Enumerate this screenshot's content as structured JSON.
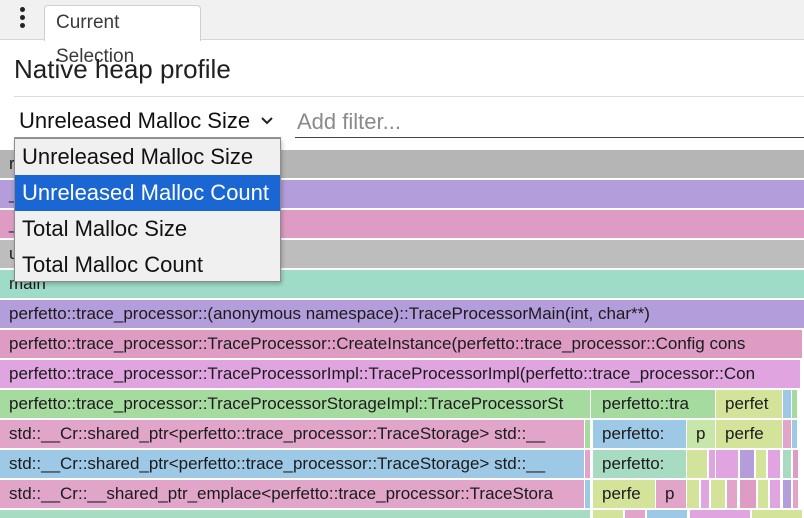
{
  "tab": {
    "label": "Current Selection"
  },
  "panel": {
    "title": "Native heap profile"
  },
  "metric_select": {
    "selected": "Unreleased Malloc Size",
    "options": [
      "Unreleased Malloc Size",
      "Unreleased Malloc Count",
      "Total Malloc Size",
      "Total Malloc Count"
    ],
    "highlighted": "Unreleased Malloc Count"
  },
  "filter": {
    "placeholder": "Add filter..."
  },
  "flamegraph": {
    "rows": [
      {
        "cells": [
          {
            "text": "r",
            "color": "#b5b5b5"
          }
        ]
      },
      {
        "cells": [
          {
            "text": "_",
            "color": "#b39ddb"
          }
        ]
      },
      {
        "cells": [
          {
            "text": "_",
            "color": "#de9cc4"
          }
        ]
      },
      {
        "cells": [
          {
            "text": "u",
            "color": "#bdbdbd"
          }
        ]
      },
      {
        "cells": [
          {
            "text": "main",
            "color": "#9fdcc7"
          }
        ]
      },
      {
        "cells": [
          {
            "text": "perfetto::trace_processor::(anonymous namespace)::TraceProcessorMain(int, char**)",
            "color": "#b39ddb"
          }
        ]
      },
      {
        "cells": [
          {
            "text": "perfetto::trace_processor::TraceProcessor::CreateInstance(perfetto::trace_processor::Config cons",
            "color": "#de9cc4"
          }
        ]
      },
      {
        "cells": [
          {
            "text": "perfetto::trace_processor::TraceProcessorImpl::TraceProcessorImpl(perfetto::trace_processor::Con",
            "color": "#e0a5e0"
          }
        ]
      },
      {
        "cells": [
          {
            "text": "perfetto::trace_processor::TraceProcessorStorageImpl::TraceProcessorSt",
            "color": "#a6dba0"
          },
          {
            "text": "perfetto::tra",
            "color": "#a6dba0"
          },
          {
            "text": "perfet",
            "color": "#d4e39a"
          }
        ]
      },
      {
        "cells": [
          {
            "text": "std::__Cr::shared_ptr<perfetto::trace_processor::TraceStorage> std::__",
            "color": "#e0a5c8"
          },
          {
            "text": "perfetto:",
            "color": "#9ec9e6"
          },
          {
            "text": "p",
            "color": "#c7e6a9"
          },
          {
            "text": "perfe",
            "color": "#d4e39a"
          }
        ]
      },
      {
        "cells": [
          {
            "text": "std::__Cr::shared_ptr<perfetto::trace_processor::TraceStorage> std::__",
            "color": "#9ec9e6"
          },
          {
            "text": "perfetto:",
            "color": "#a7dcc2"
          }
        ]
      },
      {
        "cells": [
          {
            "text": "std::__Cr::__shared_ptr_emplace<perfetto::trace_processor::TraceStora",
            "color": "#e0a5c8"
          },
          {
            "text": "perfe",
            "color": "#d4e39a"
          },
          {
            "text": "p",
            "color": "#e0a5c8"
          }
        ]
      }
    ]
  }
}
